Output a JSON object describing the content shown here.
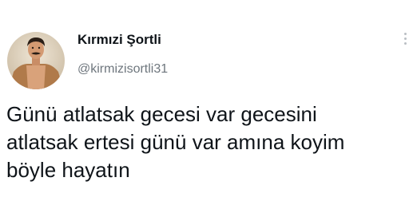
{
  "author": {
    "display_name": "Kırmızi Şortli",
    "handle": "@kirmizisortli31",
    "avatar_icon": "profile-avatar-photo"
  },
  "menu": {
    "icon": "more-vertical-icon"
  },
  "tweet": {
    "lines": [
      "Günü atlatsak gecesi var gecesini",
      "atlatsak ertesi günü var amına koyim",
      "böyle hayatın"
    ]
  },
  "colors": {
    "name": "#0f1419",
    "handle": "#6e767d",
    "text": "#0f1419",
    "menu_dots": "#b9bec3"
  }
}
